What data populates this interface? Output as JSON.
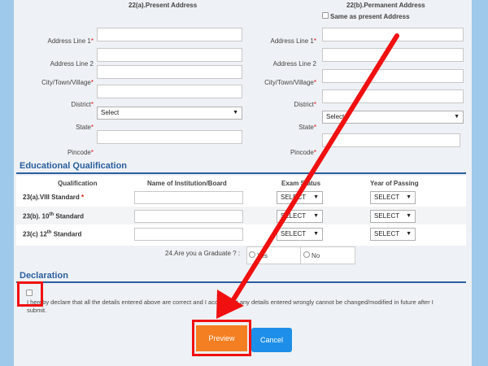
{
  "present": {
    "heading": "22(a).Present Address",
    "address_line1": "Address Line 1",
    "address_line2": "Address Line 2",
    "city": "City/Town/Village",
    "district": "District",
    "district_value": "Select",
    "state": "State",
    "pincode": "Pincode"
  },
  "permanent": {
    "heading": "22(b).Permanent Address",
    "same_as_present": "Same as present Address",
    "address_line1": "Address Line 1",
    "address_line2": "Address Line 2",
    "city": "City/Town/Village",
    "district": "District",
    "district_value": "Select",
    "state": "State",
    "pincode": "Pincode"
  },
  "required_mark": "*",
  "education": {
    "title": "Educational Qualification",
    "columns": [
      "Qualification",
      "Name of Institution/Board",
      "Exam Status",
      "Year of Passing"
    ],
    "rows": [
      {
        "label": "23(a).VIII Standard",
        "required": "*",
        "status": "SELECT",
        "year": "SELECT"
      },
      {
        "label": "23(b). 10",
        "sup": "th",
        "suffix": " Standard",
        "status": "SELECT",
        "year": "SELECT"
      },
      {
        "label": "23(c) 12",
        "sup": "th",
        "suffix": " Standard",
        "status": "SELECT",
        "year": "SELECT"
      }
    ],
    "graduate_question": "24.Are you a Graduate ? :",
    "graduate_yes": "Yes",
    "graduate_no": "No"
  },
  "declaration": {
    "title": "Declaration",
    "text_line1": "I hereby declare that all the details entered above are correct and I accept that any details entered wrongly cannot be changed/modified in future after I",
    "text_line2": "submit."
  },
  "buttons": {
    "preview": "Preview",
    "cancel": "Cancel"
  },
  "colors": {
    "accent": "#2b5f9e",
    "preview": "#f37f22",
    "cancel": "#1e8fe8",
    "annotation": "#f01010"
  }
}
